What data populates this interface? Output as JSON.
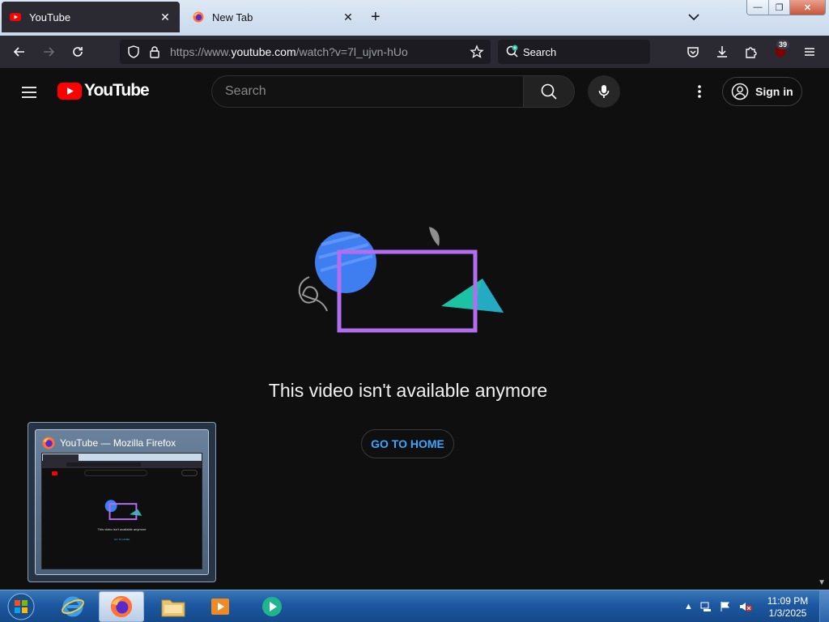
{
  "browser": {
    "tabs": [
      {
        "title": "YouTube",
        "active": true
      },
      {
        "title": "New Tab",
        "active": false
      }
    ],
    "tab_close_glyph": "✕",
    "new_tab_glyph": "+",
    "window_controls": {
      "minimize": "—",
      "maximize": "❐",
      "close": "✕"
    },
    "url": {
      "prefix": "https://www.",
      "host": "youtube.com",
      "path": "/watch?v=7l_ujvn-hUo"
    },
    "search_placeholder": "Search",
    "extension_badge": "39"
  },
  "youtube": {
    "logo_text": "YouTube",
    "search_placeholder": "Search",
    "sign_in_label": "Sign in",
    "error_message": "This video isn't available anymore",
    "go_home_label": "GO TO HOME"
  },
  "preview": {
    "title": "YouTube — Mozilla Firefox",
    "thumb_message": "This video isn't available anymore",
    "thumb_link": "GO TO HOME"
  },
  "taskbar": {
    "time": "11:09 PM",
    "date": "1/3/2025",
    "apps": [
      "internet-explorer",
      "firefox",
      "file-explorer",
      "media-player",
      "other-app"
    ]
  },
  "colors": {
    "youtube_red": "#ff0000",
    "link_blue": "#3ea6ff",
    "illustration_purple": "#b36ef0",
    "illustration_blue": "#3f7ef0",
    "illustration_teal": "#1cc2a4"
  }
}
